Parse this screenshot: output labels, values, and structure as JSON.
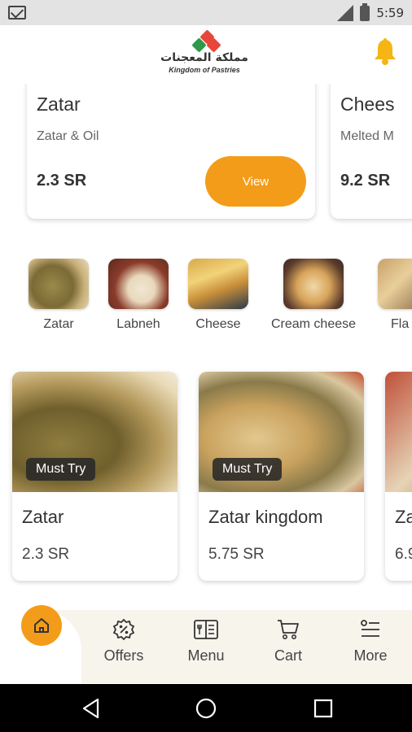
{
  "status_bar": {
    "time": "5:59"
  },
  "header": {
    "logo_arabic": "مملكة المعجنات",
    "logo_english": "Kingdom of Pastries"
  },
  "top_products": [
    {
      "name": "Zatar",
      "subtitle": "Zatar & Oil",
      "price": "2.3 SR",
      "button": "View"
    },
    {
      "name": "Chees",
      "subtitle": "Melted M",
      "price": "9.2 SR"
    }
  ],
  "categories": [
    "Zatar",
    "Labneh",
    "Cheese",
    "Cream cheese",
    "Fla"
  ],
  "featured": [
    {
      "badge": "Must Try",
      "name": "Zatar",
      "price": "2.3 SR"
    },
    {
      "badge": "Must Try",
      "name": "Zatar kingdom",
      "price": "5.75 SR"
    },
    {
      "badge": "",
      "name": "Za",
      "price": "6.9"
    }
  ],
  "bottom_nav": {
    "items": [
      {
        "label": "Offers",
        "icon": "percent-badge-icon"
      },
      {
        "label": "Menu",
        "icon": "menu-book-icon"
      },
      {
        "label": "Cart",
        "icon": "cart-icon"
      },
      {
        "label": "More",
        "icon": "list-icon"
      }
    ]
  },
  "colors": {
    "accent": "#f39c1a",
    "nav_bg": "#f7f4ec",
    "status_bar": "#e3e3e3"
  }
}
